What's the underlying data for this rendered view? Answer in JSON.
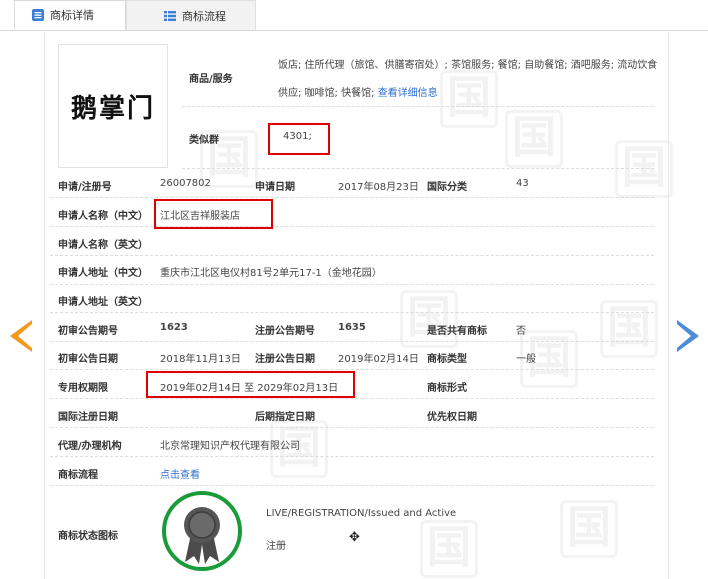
{
  "tabs": [
    {
      "label": "商标详情",
      "icon": "document-icon"
    },
    {
      "label": "商标流程",
      "icon": "list-icon"
    }
  ],
  "logo_text": "鹅掌门",
  "goods": {
    "label": "商品/服务",
    "line1": "饭店; 住所代理（旅馆、供膳寄宿处）; 茶馆服务; 餐馆; 自助餐馆; 酒吧服务; 流动饮食",
    "line2": "供应; 咖啡馆; 快餐馆;",
    "more_link": "查看详细信息"
  },
  "similar_group": {
    "label": "类似群",
    "value": "4301;"
  },
  "fields": {
    "reg_no_label": "申请/注册号",
    "reg_no": "26007802",
    "apply_date_label": "申请日期",
    "apply_date": "2017年08月23日",
    "intl_class_label": "国际分类",
    "intl_class": "43",
    "applicant_cn_label": "申请人名称（中文）",
    "applicant_cn": "江北区吉祥服装店",
    "applicant_en_label": "申请人名称（英文）",
    "address_cn_label": "申请人地址（中文）",
    "address_cn": "重庆市江北区电仪村81号2单元17-1（金地花园）",
    "address_en_label": "申请人地址（英文）",
    "prelim_no_label": "初审公告期号",
    "prelim_no": "1623",
    "reg_pub_no_label": "注册公告期号",
    "reg_pub_no": "1635",
    "shared_label": "是否共有商标",
    "shared": "否",
    "prelim_date_label": "初审公告日期",
    "prelim_date": "2018年11月13日",
    "reg_pub_date_label": "注册公告日期",
    "reg_pub_date": "2019年02月14日",
    "tm_type_label": "商标类型",
    "tm_type": "一般",
    "exclusive_label": "专用权期限",
    "exclusive": "2019年02月14日 至 2029年02月13日",
    "tm_form_label": "商标形式",
    "intl_reg_date_label": "国际注册日期",
    "later_date_label": "后期指定日期",
    "priority_date_label": "优先权日期",
    "agency_label": "代理/办理机构",
    "agency": "北京常理知识产权代理有限公司",
    "flow_label": "商标流程",
    "flow_link": "点击查看",
    "status_label": "商标状态图标",
    "status_en": "LIVE/REGISTRATION/Issued and Active",
    "status_cn": "注册"
  },
  "watermark_char": "国",
  "colors": {
    "highlight": "#e00000",
    "link": "#2f6dd1",
    "prev_arrow": "#f39a1e",
    "next_arrow": "#4a8fd6",
    "badge_ring": "#1a9b3a"
  }
}
